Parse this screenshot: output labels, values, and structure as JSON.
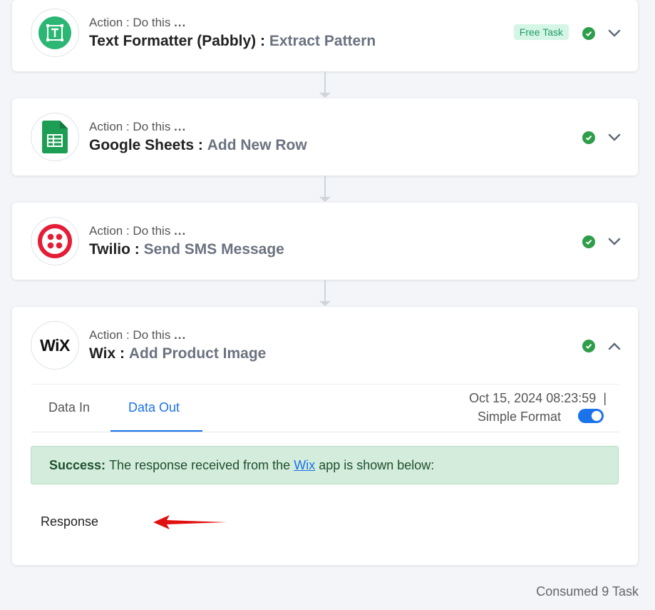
{
  "colors": {
    "accent": "#1a73e8",
    "success": "#2e9e4a",
    "background": "#f3f5f8",
    "annotation_arrow": "#e01010"
  },
  "steps": [
    {
      "icon": "text-formatter-icon",
      "sub_prefix": "Action : Do this",
      "sub_dots": "...",
      "app": "Text Formatter (Pabbly)",
      "sep": ":",
      "action": "Extract Pattern",
      "badge": "Free Task",
      "status": "success",
      "expanded": false
    },
    {
      "icon": "google-sheets-icon",
      "sub_prefix": "Action : Do this",
      "sub_dots": "...",
      "app": "Google Sheets",
      "sep": ":",
      "action": "Add New Row",
      "status": "success",
      "expanded": false
    },
    {
      "icon": "twilio-icon",
      "sub_prefix": "Action : Do this",
      "sub_dots": "...",
      "app": "Twilio",
      "sep": ":",
      "action": "Send SMS Message",
      "status": "success",
      "expanded": false
    },
    {
      "icon": "wix-icon",
      "logo_text": "WiX",
      "sub_prefix": "Action : Do this",
      "sub_dots": "...",
      "app": "Wix",
      "sep": ":",
      "action": "Add Product Image",
      "status": "success",
      "expanded": true
    }
  ],
  "panel": {
    "tabs": [
      "Data In",
      "Data Out"
    ],
    "active_tab": "Data Out",
    "timestamp": "Oct 15, 2024 08:23:59",
    "timestamp_sep": "|",
    "format_label": "Simple Format",
    "format_on": true,
    "alert": {
      "strong": "Success:",
      "before": "The response received from the",
      "link": "Wix",
      "after": "app is shown below:"
    },
    "response_label": "Response"
  },
  "footer": {
    "consumed": "Consumed 9 Task"
  }
}
